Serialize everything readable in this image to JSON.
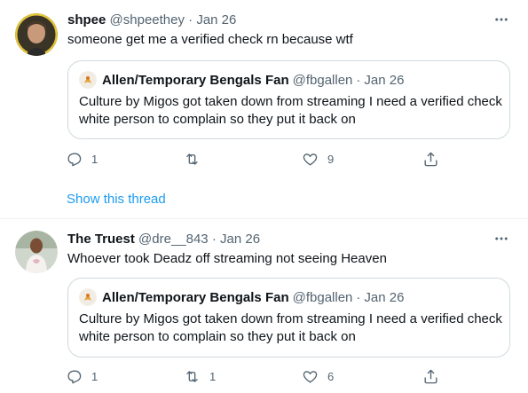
{
  "colors": {
    "accent": "#1d9bf0",
    "muted": "#536471",
    "text": "#0f1419",
    "border": "#cfd9de"
  },
  "tweets": [
    {
      "name": "shpee",
      "handle": "@shpeethey",
      "separator": "·",
      "date": "Jan 26",
      "text": "someone get me a verified check rn because wtf",
      "quote": {
        "name": "Allen/Temporary Bengals Fan",
        "handle": "@fbgallen",
        "separator": "·",
        "date": "Jan 26",
        "text": "Culture by Migos got taken down from streaming I need a verified check white person to complain so they put it back on"
      },
      "actions": {
        "replies": "1",
        "retweets": "",
        "likes": "9"
      },
      "show_thread": "Show this thread"
    },
    {
      "name": "The Truest",
      "handle": "@dre__843",
      "separator": "·",
      "date": "Jan 26",
      "text": "Whoever took Deadz off streaming not seeing Heaven",
      "quote": {
        "name": "Allen/Temporary Bengals Fan",
        "handle": "@fbgallen",
        "separator": "·",
        "date": "Jan 26",
        "text": "Culture by Migos got taken down from streaming I need a verified check white person to complain so they put it back on"
      },
      "actions": {
        "replies": "1",
        "retweets": "1",
        "likes": "6"
      }
    }
  ]
}
